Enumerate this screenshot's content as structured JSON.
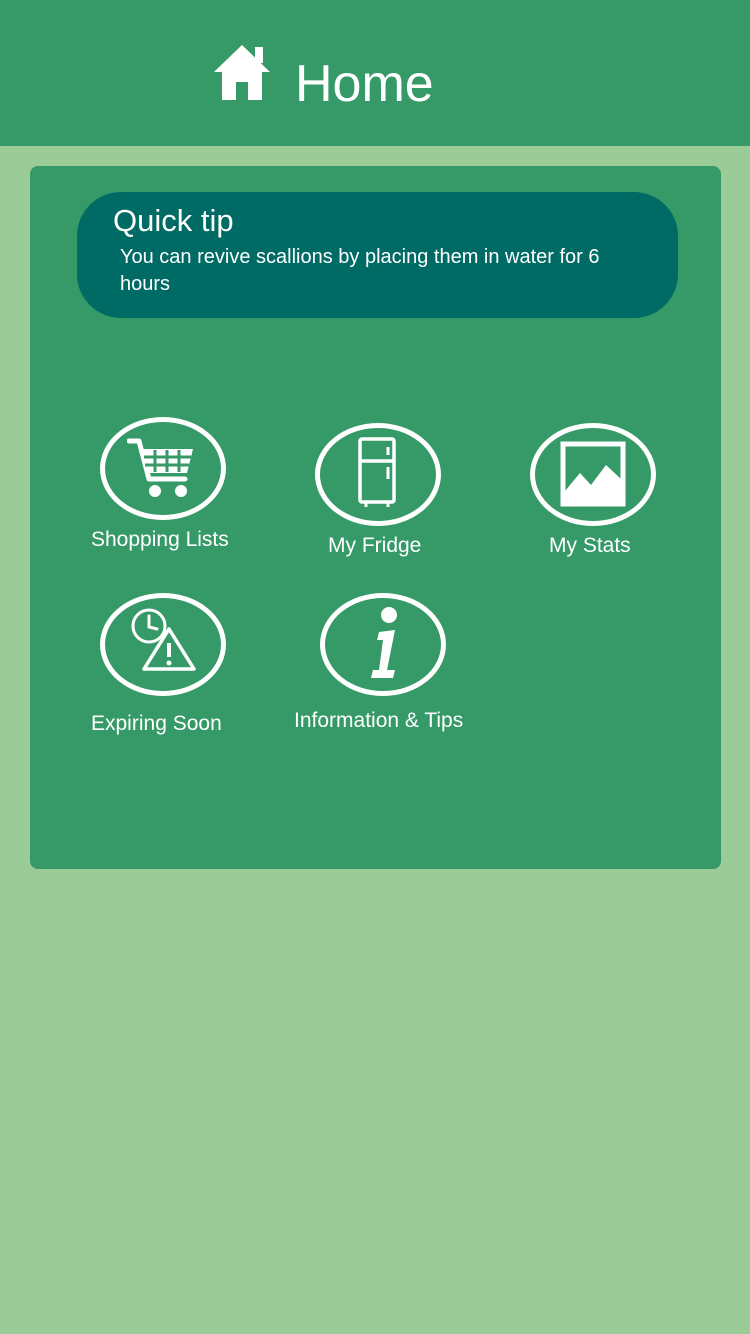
{
  "header": {
    "title": "Home",
    "icon": "home-icon"
  },
  "quick_tip": {
    "title": "Quick tip",
    "text": "You can revive scallions by placing them in water for 6 hours"
  },
  "menu": [
    {
      "label": "Shopping Lists",
      "icon": "shopping-cart-icon"
    },
    {
      "label": "My Fridge",
      "icon": "fridge-icon"
    },
    {
      "label": "My Stats",
      "icon": "stats-chart-icon"
    },
    {
      "label": "Expiring Soon",
      "icon": "clock-warning-icon"
    },
    {
      "label": "Information & Tips",
      "icon": "info-icon"
    }
  ],
  "colors": {
    "background": "#9bcc97",
    "primary": "#359a67",
    "tip_background": "#006a64",
    "text": "#ffffff"
  }
}
